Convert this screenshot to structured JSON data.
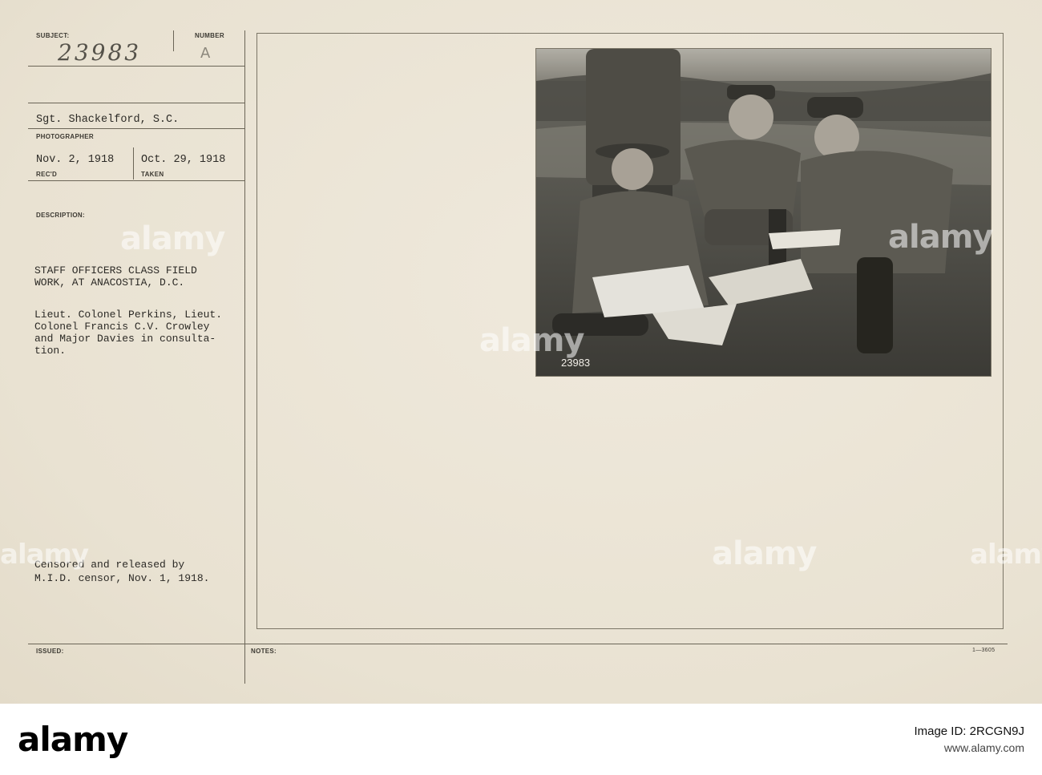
{
  "card": {
    "subject_label": "SUBJECT:",
    "subject_number": "23983",
    "number_label": "NUMBER",
    "number_value": "A",
    "photographer": "Sgt. Shackelford, S.C.",
    "photographer_label": "PHOTOGRAPHER",
    "received_date": "Nov. 2, 1918",
    "received_label": "REC'D",
    "taken_date": "Oct. 29, 1918",
    "taken_label": "TAKEN",
    "description_label": "DESCRIPTION:",
    "description_lines": [
      "STAFF OFFICERS CLASS FIELD",
      "WORK, AT ANACOSTIA, D.C.",
      "",
      "Lieut. Colonel Perkins, Lieut.",
      "Colonel Francis C.V. Crowley",
      "and Major Davies in consulta-",
      "tion."
    ],
    "censor_lines": [
      "Censored and released by",
      "M.I.D. censor, Nov. 1, 1918."
    ],
    "issued_label": "ISSUED:",
    "notes_label": "NOTES:",
    "form_code": "1—3605",
    "photo_number": "23983"
  },
  "watermark": {
    "text": "alamy"
  },
  "footer": {
    "logo": "alamy",
    "image_id": "Image ID: 2RCGN9J",
    "url": "www.alamy.com"
  },
  "colors": {
    "card": "#ece6d8",
    "ink": "#2c2a26",
    "rule": "#6b6557"
  }
}
